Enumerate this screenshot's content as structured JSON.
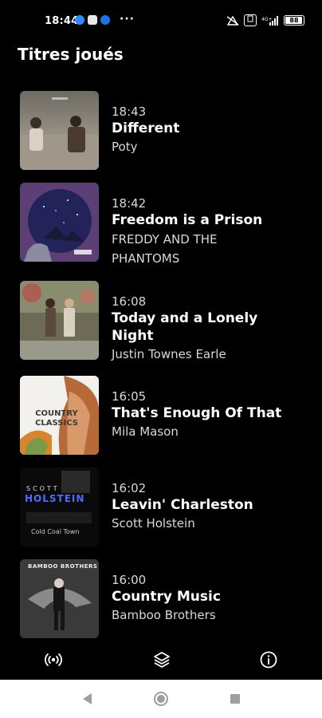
{
  "status_bar": {
    "time": "18:44",
    "more": "···",
    "network": "4G+",
    "battery": "88"
  },
  "header": {
    "title": "Titres joués"
  },
  "tracks": [
    {
      "time": "18:43",
      "title": "Different",
      "artist": "Poty"
    },
    {
      "time": "18:42",
      "title": "Freedom is a Prison",
      "artist": "FREDDY AND THE PHANTOMS"
    },
    {
      "time": "16:08",
      "title": "Today and a Lonely Night",
      "artist": "Justin Townes Earle"
    },
    {
      "time": "16:05",
      "title": "That's Enough Of That",
      "artist": "Mila Mason",
      "cover_text": "COUNTRY CLASSICS"
    },
    {
      "time": "16:02",
      "title": "Leavin' Charleston",
      "artist": "Scott Holstein",
      "cover_text": "HOLSTEIN",
      "cover_sub": "Cold Coal Town",
      "cover_top": "SCOTT"
    },
    {
      "time": "16:00",
      "title": "Country Music",
      "artist": "Bamboo Brothers",
      "cover_text": "BAMBOO BROTHERS"
    }
  ],
  "tabbar": {
    "icons": [
      "radio-broadcast-icon",
      "layers-icon",
      "info-icon"
    ]
  },
  "navbar": {
    "icons": [
      "back-triangle-icon",
      "home-circle-icon",
      "recents-square-icon"
    ]
  }
}
